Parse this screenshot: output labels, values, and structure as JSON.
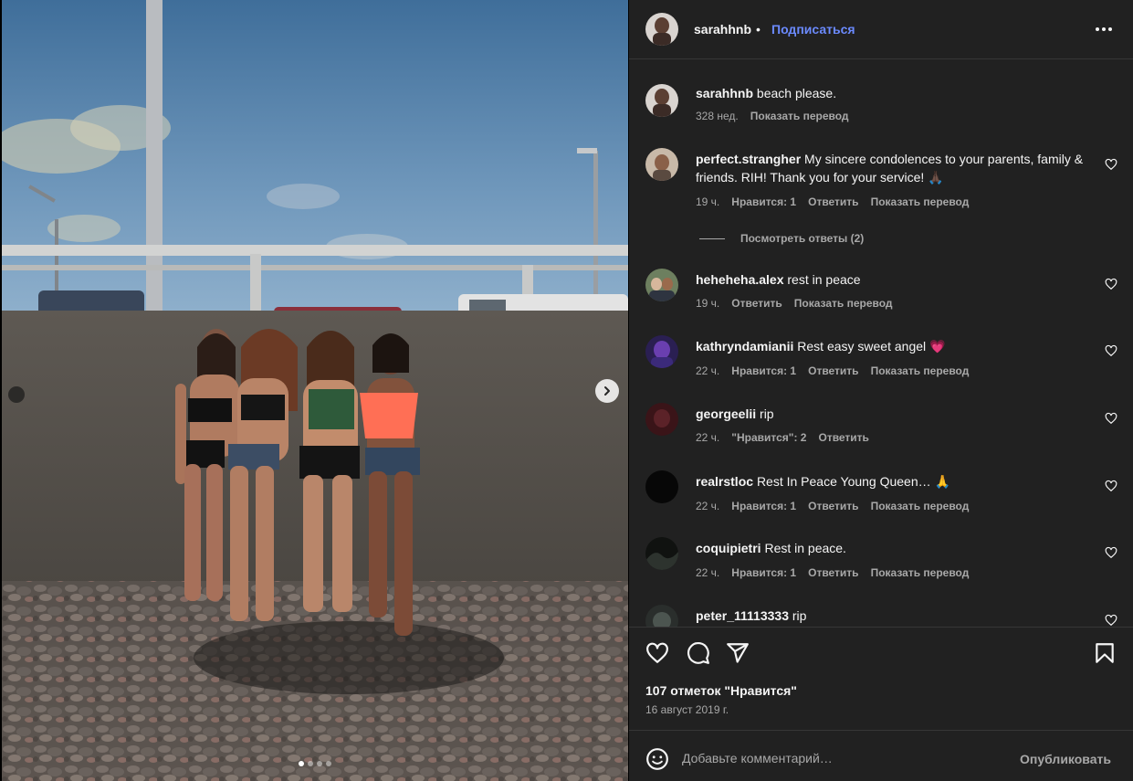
{
  "post": {
    "author": "sarahhnb",
    "separator": "•",
    "follow_label": "Подписаться",
    "caption_user": "sarahhnb",
    "caption_text": "beach please.",
    "caption_time": "328 нед.",
    "caption_translate": "Показать перевод"
  },
  "comments": [
    {
      "user": "perfect.strangher",
      "text": "My sincere condolences to your parents, family & friends. RIH! Thank you for your service! 🙏🏿",
      "time": "19 ч.",
      "likes": "Нравится: 1",
      "reply": "Ответить",
      "translate": "Показать перевод",
      "replies_label": "Посмотреть ответы (2)"
    },
    {
      "user": "heheheha.alex",
      "text": "rest in peace",
      "time": "19 ч.",
      "reply": "Ответить",
      "translate": "Показать перевод"
    },
    {
      "user": "kathryndamianii",
      "text": "Rest easy sweet angel 💗",
      "time": "22 ч.",
      "likes": "Нравится: 1",
      "reply": "Ответить",
      "translate": "Показать перевод"
    },
    {
      "user": "georgeelii",
      "text": "rip",
      "time": "22 ч.",
      "likes": "\"Нравится\": 2",
      "reply": "Ответить"
    },
    {
      "user": "realrstloc",
      "text": "Rest In Peace Young Queen… 🙏",
      "time": "22 ч.",
      "likes": "Нравится: 1",
      "reply": "Ответить",
      "translate": "Показать перевод"
    },
    {
      "user": "coquipietri",
      "text": "Rest in peace.",
      "time": "22 ч.",
      "likes": "Нравится: 1",
      "reply": "Ответить",
      "translate": "Показать перевод"
    },
    {
      "user": "peter_11113333",
      "text": "rip"
    }
  ],
  "footer": {
    "likes_count": "107 отметок \"Нравится\"",
    "date": "16 август 2019 г.",
    "comment_placeholder": "Добавьте комментарий…",
    "publish_label": "Опубликовать"
  },
  "carousel": {
    "slide_count": 4,
    "active_slide": 1
  },
  "icons": {
    "header": [
      "avatar",
      "more-options-icon"
    ],
    "actions": [
      "heart-icon",
      "comment-icon",
      "share-icon",
      "save-icon"
    ],
    "composer": [
      "emoji-icon"
    ],
    "carousel": [
      "chevron-right-icon"
    ]
  },
  "colors": {
    "panel_bg": "#212121",
    "link_blue": "#6b8aff",
    "secondary_text": "#a8a8a8",
    "primary_text": "#f5f5f5"
  }
}
